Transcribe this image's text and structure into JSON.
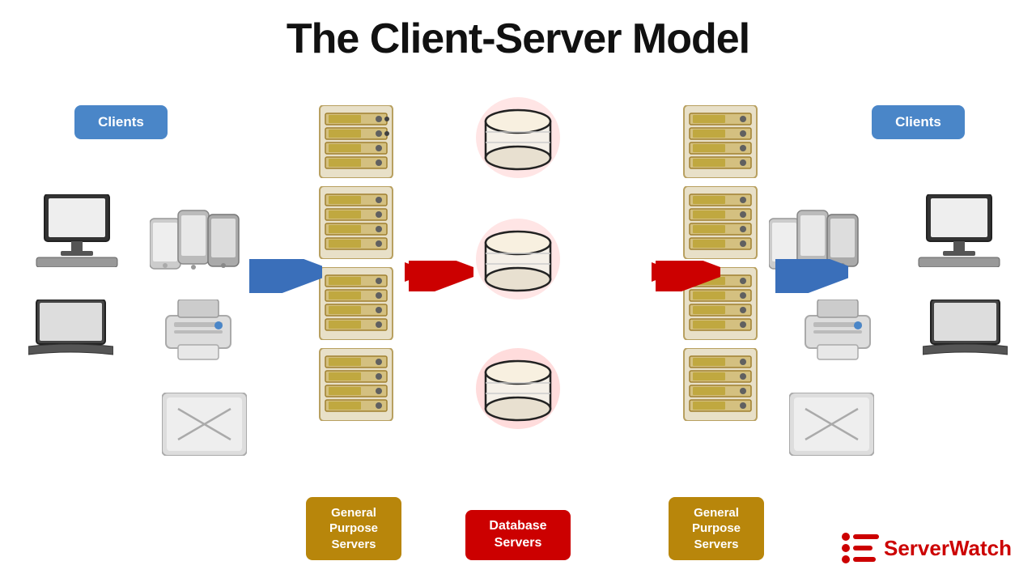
{
  "title": "The Client-Server Model",
  "labels": {
    "clients_left": "Clients",
    "clients_right": "Clients",
    "gp_left": "General Purpose Servers",
    "gp_right": "General Purpose Servers",
    "db": "Database Servers"
  },
  "logo": {
    "text_black": "Server",
    "text_red": "Watch"
  },
  "colors": {
    "blue": "#4a86c8",
    "gold": "#b8860b",
    "red": "#cc0000",
    "arrow_blue": "#3a6fba",
    "arrow_red": "#cc0000"
  }
}
